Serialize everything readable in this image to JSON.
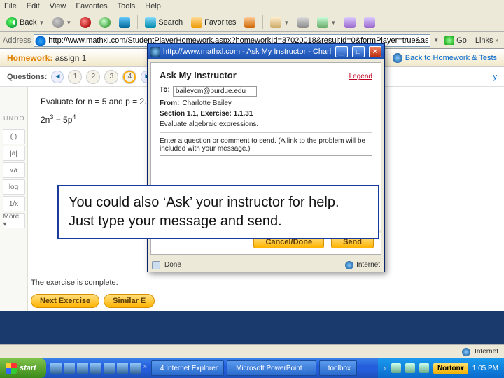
{
  "menubar": [
    "File",
    "Edit",
    "View",
    "Favorites",
    "Tools",
    "Help"
  ],
  "toolbar": {
    "back": "Back",
    "search": "Search",
    "favorites": "Favorites"
  },
  "addressbar": {
    "label": "Address",
    "url": "http://www.mathxl.com/StudentPlayerHomework.aspx?homeworkId=37020018&resultId=0&formPlayer=true&ask=yes",
    "go": "Go",
    "links": "Links"
  },
  "homework": {
    "label": "Homework:",
    "title": "assign 1",
    "back_link": "Back to Homework & Tests"
  },
  "questions": {
    "label": "Questions:",
    "nums": [
      "1",
      "2",
      "3",
      "4"
    ],
    "right_label": "y"
  },
  "problem": {
    "prompt": "Evaluate for n = 5 and p = 2.",
    "expr_a": "2n",
    "expr_a_sup": "3",
    "expr_mid": " − 5p",
    "expr_b_sup": "4",
    "complete": "The exercise is complete.",
    "undo": "UNDO",
    "tools": [
      "( )",
      "|a|",
      "√a",
      "log",
      "1/x",
      "More ▾"
    ]
  },
  "actions": {
    "next": "Next Exercise",
    "similar": "Similar E"
  },
  "modal": {
    "title": "http://www.mathxl.com - Ask My Instructor - Charlotte Bailey - ...",
    "heading": "Ask My Instructor",
    "legend": "Legend",
    "to_label": "To:",
    "to_value": "baileycm@purdue.edu",
    "from_label": "From:",
    "from_value": "Charlotte Bailey",
    "section_label": "Section 1.1, Exercise: 1.1.31",
    "subprompt": "Evaluate algebraic expressions.",
    "instructions": "Enter a question or comment to send. (A link to the problem will be included with your message.)",
    "cancel": "Cancel/Done",
    "send": "Send",
    "status_done": "Done",
    "status_zone": "Internet"
  },
  "caption": "You could also ‘Ask’ your instructor for help.  Just type your message and send.",
  "ie_status": {
    "zone": "Internet"
  },
  "taskbar": {
    "start": "start",
    "tasks": [
      {
        "icon": "ie",
        "label": "4 Internet Explorer"
      },
      {
        "icon": "ppt",
        "label": "Microsoft PowerPoint ..."
      },
      {
        "icon": "fold",
        "label": "toolbox"
      }
    ],
    "norton": "Norton",
    "clock": "1:05 PM"
  }
}
